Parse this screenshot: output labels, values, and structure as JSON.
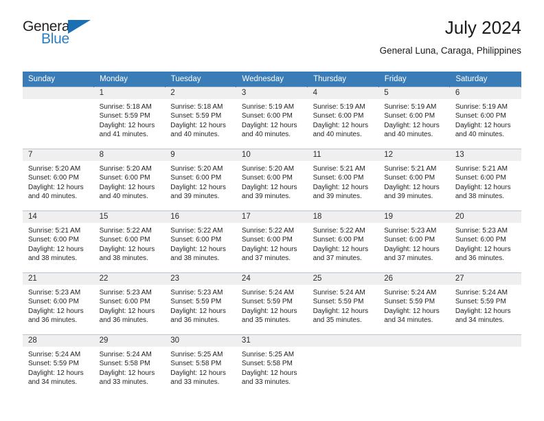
{
  "brand": {
    "name_dark": "General",
    "name_blue": "Blue",
    "accent_color": "#2a7fc4",
    "header_color": "#3a7cb8"
  },
  "header": {
    "title": "July 2024",
    "subtitle": "General Luna, Caraga, Philippines"
  },
  "weekdays": [
    "Sunday",
    "Monday",
    "Tuesday",
    "Wednesday",
    "Thursday",
    "Friday",
    "Saturday"
  ],
  "labels": {
    "sunrise_prefix": "Sunrise:",
    "sunset_prefix": "Sunset:",
    "daylight_prefix": "Daylight:"
  },
  "weeks": [
    [
      {
        "day": "",
        "sunrise": "",
        "sunset": "",
        "daylight_line1": "",
        "daylight_line2": "",
        "empty": true
      },
      {
        "day": "1",
        "sunrise": "Sunrise: 5:18 AM",
        "sunset": "Sunset: 5:59 PM",
        "daylight_line1": "Daylight: 12 hours",
        "daylight_line2": "and 41 minutes."
      },
      {
        "day": "2",
        "sunrise": "Sunrise: 5:18 AM",
        "sunset": "Sunset: 5:59 PM",
        "daylight_line1": "Daylight: 12 hours",
        "daylight_line2": "and 40 minutes."
      },
      {
        "day": "3",
        "sunrise": "Sunrise: 5:19 AM",
        "sunset": "Sunset: 6:00 PM",
        "daylight_line1": "Daylight: 12 hours",
        "daylight_line2": "and 40 minutes."
      },
      {
        "day": "4",
        "sunrise": "Sunrise: 5:19 AM",
        "sunset": "Sunset: 6:00 PM",
        "daylight_line1": "Daylight: 12 hours",
        "daylight_line2": "and 40 minutes."
      },
      {
        "day": "5",
        "sunrise": "Sunrise: 5:19 AM",
        "sunset": "Sunset: 6:00 PM",
        "daylight_line1": "Daylight: 12 hours",
        "daylight_line2": "and 40 minutes."
      },
      {
        "day": "6",
        "sunrise": "Sunrise: 5:19 AM",
        "sunset": "Sunset: 6:00 PM",
        "daylight_line1": "Daylight: 12 hours",
        "daylight_line2": "and 40 minutes."
      }
    ],
    [
      {
        "day": "7",
        "sunrise": "Sunrise: 5:20 AM",
        "sunset": "Sunset: 6:00 PM",
        "daylight_line1": "Daylight: 12 hours",
        "daylight_line2": "and 40 minutes."
      },
      {
        "day": "8",
        "sunrise": "Sunrise: 5:20 AM",
        "sunset": "Sunset: 6:00 PM",
        "daylight_line1": "Daylight: 12 hours",
        "daylight_line2": "and 40 minutes."
      },
      {
        "day": "9",
        "sunrise": "Sunrise: 5:20 AM",
        "sunset": "Sunset: 6:00 PM",
        "daylight_line1": "Daylight: 12 hours",
        "daylight_line2": "and 39 minutes."
      },
      {
        "day": "10",
        "sunrise": "Sunrise: 5:20 AM",
        "sunset": "Sunset: 6:00 PM",
        "daylight_line1": "Daylight: 12 hours",
        "daylight_line2": "and 39 minutes."
      },
      {
        "day": "11",
        "sunrise": "Sunrise: 5:21 AM",
        "sunset": "Sunset: 6:00 PM",
        "daylight_line1": "Daylight: 12 hours",
        "daylight_line2": "and 39 minutes."
      },
      {
        "day": "12",
        "sunrise": "Sunrise: 5:21 AM",
        "sunset": "Sunset: 6:00 PM",
        "daylight_line1": "Daylight: 12 hours",
        "daylight_line2": "and 39 minutes."
      },
      {
        "day": "13",
        "sunrise": "Sunrise: 5:21 AM",
        "sunset": "Sunset: 6:00 PM",
        "daylight_line1": "Daylight: 12 hours",
        "daylight_line2": "and 38 minutes."
      }
    ],
    [
      {
        "day": "14",
        "sunrise": "Sunrise: 5:21 AM",
        "sunset": "Sunset: 6:00 PM",
        "daylight_line1": "Daylight: 12 hours",
        "daylight_line2": "and 38 minutes."
      },
      {
        "day": "15",
        "sunrise": "Sunrise: 5:22 AM",
        "sunset": "Sunset: 6:00 PM",
        "daylight_line1": "Daylight: 12 hours",
        "daylight_line2": "and 38 minutes."
      },
      {
        "day": "16",
        "sunrise": "Sunrise: 5:22 AM",
        "sunset": "Sunset: 6:00 PM",
        "daylight_line1": "Daylight: 12 hours",
        "daylight_line2": "and 38 minutes."
      },
      {
        "day": "17",
        "sunrise": "Sunrise: 5:22 AM",
        "sunset": "Sunset: 6:00 PM",
        "daylight_line1": "Daylight: 12 hours",
        "daylight_line2": "and 37 minutes."
      },
      {
        "day": "18",
        "sunrise": "Sunrise: 5:22 AM",
        "sunset": "Sunset: 6:00 PM",
        "daylight_line1": "Daylight: 12 hours",
        "daylight_line2": "and 37 minutes."
      },
      {
        "day": "19",
        "sunrise": "Sunrise: 5:23 AM",
        "sunset": "Sunset: 6:00 PM",
        "daylight_line1": "Daylight: 12 hours",
        "daylight_line2": "and 37 minutes."
      },
      {
        "day": "20",
        "sunrise": "Sunrise: 5:23 AM",
        "sunset": "Sunset: 6:00 PM",
        "daylight_line1": "Daylight: 12 hours",
        "daylight_line2": "and 36 minutes."
      }
    ],
    [
      {
        "day": "21",
        "sunrise": "Sunrise: 5:23 AM",
        "sunset": "Sunset: 6:00 PM",
        "daylight_line1": "Daylight: 12 hours",
        "daylight_line2": "and 36 minutes."
      },
      {
        "day": "22",
        "sunrise": "Sunrise: 5:23 AM",
        "sunset": "Sunset: 6:00 PM",
        "daylight_line1": "Daylight: 12 hours",
        "daylight_line2": "and 36 minutes."
      },
      {
        "day": "23",
        "sunrise": "Sunrise: 5:23 AM",
        "sunset": "Sunset: 5:59 PM",
        "daylight_line1": "Daylight: 12 hours",
        "daylight_line2": "and 36 minutes."
      },
      {
        "day": "24",
        "sunrise": "Sunrise: 5:24 AM",
        "sunset": "Sunset: 5:59 PM",
        "daylight_line1": "Daylight: 12 hours",
        "daylight_line2": "and 35 minutes."
      },
      {
        "day": "25",
        "sunrise": "Sunrise: 5:24 AM",
        "sunset": "Sunset: 5:59 PM",
        "daylight_line1": "Daylight: 12 hours",
        "daylight_line2": "and 35 minutes."
      },
      {
        "day": "26",
        "sunrise": "Sunrise: 5:24 AM",
        "sunset": "Sunset: 5:59 PM",
        "daylight_line1": "Daylight: 12 hours",
        "daylight_line2": "and 34 minutes."
      },
      {
        "day": "27",
        "sunrise": "Sunrise: 5:24 AM",
        "sunset": "Sunset: 5:59 PM",
        "daylight_line1": "Daylight: 12 hours",
        "daylight_line2": "and 34 minutes."
      }
    ],
    [
      {
        "day": "28",
        "sunrise": "Sunrise: 5:24 AM",
        "sunset": "Sunset: 5:59 PM",
        "daylight_line1": "Daylight: 12 hours",
        "daylight_line2": "and 34 minutes."
      },
      {
        "day": "29",
        "sunrise": "Sunrise: 5:24 AM",
        "sunset": "Sunset: 5:58 PM",
        "daylight_line1": "Daylight: 12 hours",
        "daylight_line2": "and 33 minutes."
      },
      {
        "day": "30",
        "sunrise": "Sunrise: 5:25 AM",
        "sunset": "Sunset: 5:58 PM",
        "daylight_line1": "Daylight: 12 hours",
        "daylight_line2": "and 33 minutes."
      },
      {
        "day": "31",
        "sunrise": "Sunrise: 5:25 AM",
        "sunset": "Sunset: 5:58 PM",
        "daylight_line1": "Daylight: 12 hours",
        "daylight_line2": "and 33 minutes."
      },
      {
        "day": "",
        "sunrise": "",
        "sunset": "",
        "daylight_line1": "",
        "daylight_line2": "",
        "empty": true
      },
      {
        "day": "",
        "sunrise": "",
        "sunset": "",
        "daylight_line1": "",
        "daylight_line2": "",
        "empty": true
      },
      {
        "day": "",
        "sunrise": "",
        "sunset": "",
        "daylight_line1": "",
        "daylight_line2": "",
        "empty": true
      }
    ]
  ]
}
